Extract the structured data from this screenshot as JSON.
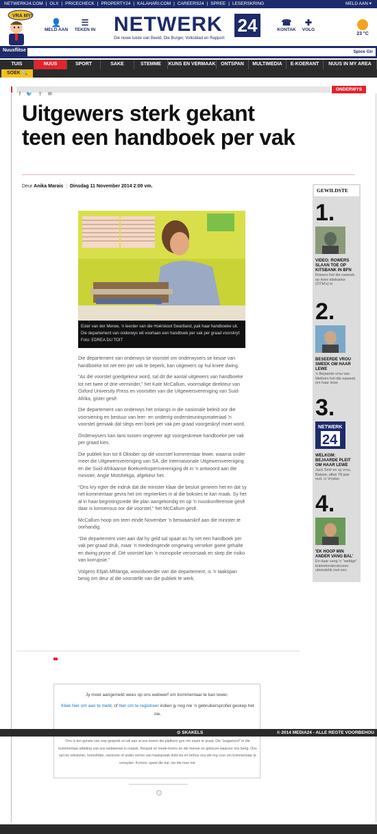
{
  "topbar": {
    "links": [
      "NETWERK24.COM",
      "OLX",
      "PRICECHECK",
      "PROPERTY24",
      "KALAHARI.COM",
      "CAREERS24",
      "SPREE",
      "LESERSKRING"
    ],
    "login": "MELD AAN ▾"
  },
  "header": {
    "mascot_text": "VRA MY!",
    "meld_aan": "MELD AAN",
    "teken_in": "TEKEN IN",
    "logo_word": "NETWERK",
    "logo_num": "24",
    "logo_tag": "Die nuwe tuiste van Beeld, Die Burger, Volksblad en Rapport",
    "kontak": "KONTAK",
    "volg": "VOLG",
    "temperature": "23 °C"
  },
  "ticker": {
    "label": "Nuusflitse",
    "text": "Spice Gir"
  },
  "nav": {
    "items": [
      "TUIS",
      "NUUS",
      "SPORT",
      "SAKE",
      "STEMME",
      "KUNS EN VERMAAK",
      "ONTSPAN",
      "MULTIMEDIA",
      "E-KOERANT",
      "NUUS IN MY AREA"
    ],
    "active": "NUUS",
    "search": "SOEK"
  },
  "article": {
    "section": "ONDERWYS",
    "title": "Uitgewers sterk gekant teen een handboek per vak",
    "byline_prefix": "Deur",
    "author": "Anika Marais",
    "date": "Dinsdag 11 November 2014 2:00 vm.",
    "caption": "Ester van der Merwe, 'n leerder van die Hoërskool Swartland, pak haar handboeke uit. Die departement van onderwys wil voortaan een handboek per vak per graad voorskryf. Foto: EDREA DU TOIT",
    "paragraphs": [
      "Die departement van onderwys se voorstel om onderwysers se keuse van handboeke tot net een per vak te beperk, kan uitgewers op hul knieë dwing.",
      "“As dié voorstel goedgekeur word, sal dit die aantal uitgewers van handboeke tot net twee of drie verminder,” het Kate McCallum, voormalige direkteur van Oxford University Press en voorsitter van die Uitgewersvereniging van Suid-Afrika, gister gesê.",
      "Die departement van onderwys het onlangs in die nasionale beleid oor die voorsiening en bestuur van leer- en onderrig-ondersteuningsmateriaal ’n voorstel gemaak dat slegs een boek per vak per graad voorgeskryf moet word.",
      "Onderwysers kan tans tussen ongeveer agt voorgeskrewe handboeke per vak per graad kies.",
      "Die publiek kon tot 8 Oktober op dié voorstel kommentaar lewer, waarna onder meer die Uitgewersvereniging van SA, die Internasionale Uitgewersvereniging en die Suid-Afrikaanse Boekverkopersvereniging dit in ’n antwoord aan die minister, Angie Motshekga, afgekeur het.",
      "“Ons kry egter die indruk dat die minister klaar die besluit geneem het en dat sy net kommentaar gevra het om regmerkies in al die boksies te kan maak. Sy het al in haar begrotingsrede die plan aangekondig en op ’n nuuskonferensie gesê daar is konsensus oor dié voorstel,” het McCallum gesê.",
      "McCallum hoop om teen einde November ’n beswaarskrif aan die minister te oorhandig.",
      "“Die departement voer aan dat hy geld sal spaar as hy net een handboek per vak per graad druk, maar ’n mededingende omgewing verseker goeie gehalte en dwing pryse af. Dié voorstel kan ’n monopolie veroorsaak en skep die risiko van korrupsie.”",
      "Volgens Elijah Mhlanga, woordvoerder van die departement, is ’n taakspan besig om deur al die voorstelle van die publiek te werk."
    ]
  },
  "sidebar": {
    "heading": "GEWILDSTE",
    "items": [
      {
        "num": "1.",
        "title": "VIDEO: ROWERS SLAAN TOE OP KITSBANK IN BFN",
        "desc": "Rowers het die naweek op twee kitsbanke (OTM's) in"
      },
      {
        "num": "2.",
        "title": "BESEERDE VROU SMEEK OM HAAR LEWE",
        "desc": "'n Bejaarde vrou van Welkom het die naweek om haar lewe"
      },
      {
        "num": "3.",
        "title": "WELKOM: BEJAARDE PLEIT OM HAAR LEWE",
        "desc": "Jack Smit en sy vrou, Babsie, albei 78 jaar oud, is Vrydao"
      },
      {
        "num": "4.",
        "title": "'EK HOOP MIN ANDER VANG BAL'",
        "desc": "En daar vang 'n “wettige” krieketondersteuner uiteindelik met een"
      }
    ]
  },
  "comments": {
    "line1": "Jy moet aangemeld wees op ons webwerf om kommentaar te kan lewer.",
    "link1": "Kliek hier om aan te meld",
    "mid": ", of",
    "link2": "hier om te registreer",
    "tail": " indien jy nog nie ’n gebruikersprofiel geskep het nie.",
    "rules": "Ons is ten gunste van oop gesprek en wil aan al ons lesers die platform gun om saam te praat. Die \"wagwoord\" in die kommentaar-afdeling van ons webwerwe is respek. Respek vir mede-lesers en die mense en gebeure waaroor ons berig. Ons sal nie seksisme, homofobie, rassisme of ander vorms van haatspraak duld nie en behou ons die reg voor om kommentaar te verwyder. Kortom, speel die bal, nie die man nie."
  },
  "footer": {
    "skakels": "SKAKELS",
    "copyright": "© 2014 MEDIA24 - ALLE REGTE VOORBEHOU"
  },
  "colors": {
    "brand": "#1d2b6b",
    "accent": "#e2242c",
    "search": "#f3c11b"
  }
}
